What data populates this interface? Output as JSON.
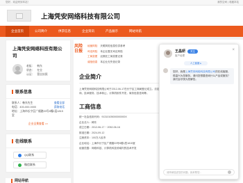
{
  "topbar": {
    "left": "您好，欢迎来到本站！",
    "right": "我的空间 | 收藏本站"
  },
  "header": {
    "company_name": "上海凭安网络科技有限公司"
  },
  "nav": {
    "items": [
      {
        "label": "企业首页"
      },
      {
        "label": "公司简介"
      },
      {
        "label": "供求信息"
      },
      {
        "label": "企业资讯"
      },
      {
        "label": "产品展示"
      },
      {
        "label": "网站导航"
      }
    ]
  },
  "left": {
    "company_name": "上海凭安网络科技有限公司",
    "owner_label": "老板：",
    "owner_value": "韩东",
    "status_label": "状态：",
    "status_value": "在业",
    "auth_label": "认证：",
    "auth_value": "营业执照",
    "contact_title": "联系信息",
    "contact_lines": [
      {
        "label": "联系人：",
        "value": "韩东先生",
        "link": "查看全部"
      },
      {
        "label": "电话：",
        "value": "400-000-0000",
        "link": "获取电话"
      },
      {
        "label": "地址：",
        "value": "上海市长宁区广顺路33号8幢1层1815室",
        "link": ""
      }
    ],
    "more_link": "企业全景查看 >>",
    "online_title": "在线联系",
    "qq_label": "QQ联系",
    "wechat_label": "微信联系",
    "floor_title": "网站导航"
  },
  "news": {
    "tag": "风险日报",
    "items": [
      {
        "chip": "经营风险",
        "text": "天眼风险信息仅供参考"
      },
      {
        "chip": "司法风险",
        "text": "本企业暂无司法风险"
      },
      {
        "chip": "工商变更",
        "text": "近期无工商变更记录"
      },
      {
        "chip": "诚信信息",
        "text": "本企业无失信记录"
      }
    ]
  },
  "intro": {
    "title": "企业简介",
    "text": "上海凭安网络科技有限公司于2012-06-17在长宁区工商局登记成立。法定代表人韩东，公司经营范围包括：网络科技领域内的技术开发、技术咨询、技术服务、技术转让，计算机软件开发，商务信息咨询等。"
  },
  "biz": {
    "title": "工商信息",
    "rows": [
      "统一社会信用代码：91310105000000000X",
      "企业法人：韩东",
      "成立日期：2012-06-17 ~ 2052-06-16",
      "核准日期：2024-09-12",
      "注册资本：100万人民币",
      "企业地址：上海市长宁区广顺路33号8幢1层1815室",
      "经营范围：网络科技、计算机科技领域内的技术开发"
    ]
  },
  "chat": {
    "name": "王晶妍",
    "subtitle": "客户经理",
    "follow_label": "关注",
    "chip": "人工客服 ▸",
    "greeting_lead": "您好，我是",
    "company_hl": "上海凭安网络科技有限公司",
    "greeting_tail": "的在线客服，很高兴为您服务。请问您想要咨询什么产品或服务？我们会尽快为您解答。",
    "input_placeholder": "请简单描述您的问题，我来帮您..."
  }
}
